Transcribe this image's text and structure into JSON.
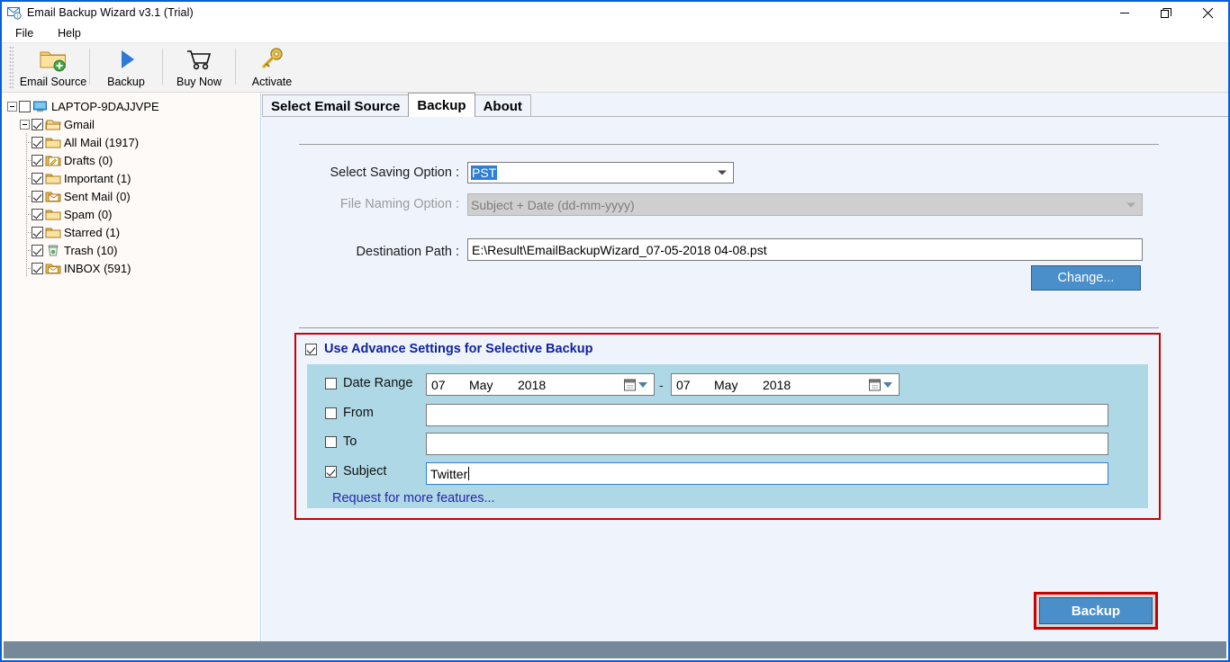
{
  "window": {
    "title": "Email Backup Wizard v3.1 (Trial)",
    "app_icon": "envelope-app-icon",
    "minimize_label": "—",
    "maximize_label": "❐",
    "close_label": "✕"
  },
  "menu": {
    "items": [
      {
        "label": "File",
        "name": "menu-file"
      },
      {
        "label": "Help",
        "name": "menu-help"
      }
    ]
  },
  "toolbar": {
    "buttons": [
      {
        "label": "Email Source",
        "icon": "folder-add-icon",
        "name": "toolbar-email-source"
      },
      {
        "label": "Backup",
        "icon": "play-triangle-icon",
        "name": "toolbar-backup"
      },
      {
        "label": "Buy Now",
        "icon": "shopping-cart-icon",
        "name": "toolbar-buy-now"
      },
      {
        "label": "Activate",
        "icon": "key-icon",
        "name": "toolbar-activate"
      }
    ]
  },
  "tree": {
    "root": {
      "label": "LAPTOP-9DAJJVPE",
      "checked": false,
      "icon": "computer-icon",
      "expanded": true
    },
    "account": {
      "label": "Gmail",
      "checked": true,
      "icon": "folders-stack-icon",
      "expanded": true
    },
    "folders": [
      {
        "label": "All Mail (1917)",
        "checked": true,
        "icon": "folder-icon"
      },
      {
        "label": "Drafts (0)",
        "checked": true,
        "icon": "folder-draft-icon"
      },
      {
        "label": "Important (1)",
        "checked": true,
        "icon": "folder-icon"
      },
      {
        "label": "Sent Mail (0)",
        "checked": true,
        "icon": "folder-sent-icon"
      },
      {
        "label": "Spam (0)",
        "checked": true,
        "icon": "folder-icon"
      },
      {
        "label": "Starred (1)",
        "checked": true,
        "icon": "folder-icon"
      },
      {
        "label": "Trash (10)",
        "checked": true,
        "icon": "trash-icon"
      },
      {
        "label": "INBOX (591)",
        "checked": true,
        "icon": "folder-inbox-icon"
      }
    ]
  },
  "tabs": [
    {
      "label": "Select Email Source",
      "name": "tab-select-email-source",
      "active": false
    },
    {
      "label": "Backup",
      "name": "tab-backup",
      "active": true
    },
    {
      "label": "About",
      "name": "tab-about",
      "active": false
    }
  ],
  "form": {
    "saving_option_label": "Select Saving Option :",
    "saving_option_value": "PST",
    "file_naming_label": "File Naming Option :",
    "file_naming_value": "Subject + Date (dd-mm-yyyy)",
    "file_naming_disabled": true,
    "destination_label": "Destination Path :",
    "destination_value": "E:\\Result\\EmailBackupWizard_07-05-2018 04-08.pst",
    "change_button": "Change..."
  },
  "advanced": {
    "header_label": "Use Advance Settings for Selective Backup",
    "header_checked": true,
    "date_range": {
      "label": "Date Range",
      "checked": false,
      "from": {
        "day": "07",
        "month": "May",
        "year": "2018"
      },
      "to": {
        "day": "07",
        "month": "May",
        "year": "2018"
      },
      "separator": "-"
    },
    "from": {
      "label": "From",
      "checked": false,
      "value": ""
    },
    "to": {
      "label": "To",
      "checked": false,
      "value": ""
    },
    "subject": {
      "label": "Subject",
      "checked": true,
      "value": "Twitter"
    },
    "request_link": "Request for more features..."
  },
  "footer": {
    "backup_button": "Backup"
  },
  "colors": {
    "accent_blue": "#4a8fc9",
    "highlight_red": "#cc0000",
    "advanced_panel": "#aed8e6",
    "main_background": "#eff4fc",
    "link_navy": "#2727a8",
    "header_navy": "#10239e",
    "status_bar": "#78889b"
  }
}
